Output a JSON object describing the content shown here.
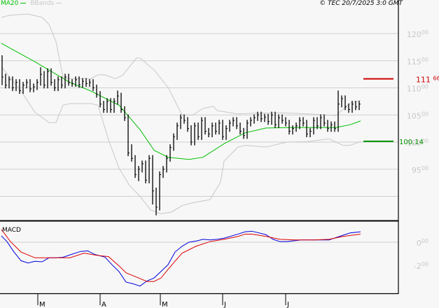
{
  "header": {
    "legend": [
      {
        "label": "MA20",
        "color": "#00c000"
      },
      {
        "label": "BBands",
        "color": "#c8c8c8"
      }
    ],
    "copyright": "© TEC 20/7/2025 3:0 GMT"
  },
  "chart_data": [
    {
      "type": "ohlc",
      "panel": "price",
      "ylim": [
        85,
        123
      ],
      "grid": true,
      "y_ticks": [
        {
          "value": 120,
          "int": "120",
          "dec": "00"
        },
        {
          "value": 115,
          "int": "115",
          "dec": "00"
        },
        {
          "value": 110,
          "int": "110",
          "dec": "00"
        },
        {
          "value": 105,
          "int": "105",
          "dec": "00"
        },
        {
          "value": 100,
          "int": "100",
          "dec": "00"
        },
        {
          "value": 95,
          "int": "95",
          "dec": "00"
        }
      ],
      "x_ticks": [
        {
          "bar": 10.2,
          "label": "M"
        },
        {
          "bar": 28,
          "label": "A"
        },
        {
          "bar": 45.2,
          "label": "M"
        },
        {
          "bar": 63,
          "label": "J"
        },
        {
          "bar": 81,
          "label": "J"
        }
      ],
      "bars_hlc": [
        [
          116,
          110.5,
          112
        ],
        [
          112.6,
          109.9,
          110.5
        ],
        [
          112.1,
          109.9,
          111.5
        ],
        [
          112.1,
          109.4,
          110
        ],
        [
          111.6,
          109.4,
          111
        ],
        [
          111.6,
          108.9,
          109.5
        ],
        [
          111.1,
          108.9,
          110.5
        ],
        [
          111.6,
          109.9,
          111
        ],
        [
          111.6,
          109.2,
          109.8
        ],
        [
          110.8,
          109.2,
          110.2
        ],
        [
          111.6,
          109.6,
          111
        ],
        [
          113.8,
          110.4,
          112.5
        ],
        [
          113.1,
          109.9,
          110.5
        ],
        [
          113.6,
          109.9,
          113
        ],
        [
          113.6,
          110.4,
          111
        ],
        [
          111.6,
          109.4,
          110
        ],
        [
          112.1,
          109.4,
          111.5
        ],
        [
          112.1,
          109.9,
          110.5
        ],
        [
          112.6,
          109.9,
          112
        ],
        [
          112.6,
          110.4,
          111
        ],
        [
          111.6,
          110.2,
          110.8
        ],
        [
          112.1,
          110.2,
          111.5
        ],
        [
          112.1,
          110,
          110.6
        ],
        [
          111.8,
          110,
          111.2
        ],
        [
          111.8,
          110.2,
          110.8
        ],
        [
          111.6,
          110.2,
          111
        ],
        [
          111.6,
          109.4,
          110
        ],
        [
          110.6,
          108.2,
          108.8
        ],
        [
          109.4,
          106.4,
          107
        ],
        [
          107.6,
          105.4,
          106
        ],
        [
          108.1,
          105.4,
          107.5
        ],
        [
          108.1,
          105.4,
          106
        ],
        [
          108.1,
          105.4,
          107.5
        ],
        [
          109.5,
          106.9,
          108.5
        ],
        [
          109.1,
          105.4,
          106
        ],
        [
          106.6,
          103.9,
          104.5
        ],
        [
          105.1,
          97.4,
          98
        ],
        [
          99.6,
          96.4,
          97
        ],
        [
          97.6,
          93.4,
          94
        ],
        [
          95.6,
          92.8,
          95
        ],
        [
          96.6,
          94.4,
          96
        ],
        [
          96.6,
          92.4,
          93
        ],
        [
          97.6,
          92.4,
          97
        ],
        [
          97.6,
          88.5,
          91
        ],
        [
          91.6,
          86.5,
          88
        ],
        [
          94.6,
          87.4,
          94
        ],
        [
          95.6,
          93.4,
          95
        ],
        [
          97.6,
          94.4,
          97
        ],
        [
          99.6,
          96.4,
          99
        ],
        [
          101.6,
          98.4,
          101
        ],
        [
          103.6,
          100.4,
          103
        ],
        [
          105.1,
          102.4,
          104.5
        ],
        [
          105.1,
          103.4,
          104
        ],
        [
          104.6,
          101.9,
          102.5
        ],
        [
          103.1,
          99.4,
          100
        ],
        [
          103.6,
          99.4,
          103
        ],
        [
          103.6,
          100.4,
          101
        ],
        [
          104.6,
          100.4,
          104
        ],
        [
          104.6,
          101.4,
          102
        ],
        [
          102.6,
          100.9,
          101.5
        ],
        [
          103.6,
          100.9,
          103
        ],
        [
          103.6,
          101.4,
          102
        ],
        [
          104.1,
          101.4,
          103.5
        ],
        [
          104.1,
          100.4,
          101
        ],
        [
          103.1,
          100.4,
          102.5
        ],
        [
          104.1,
          101.9,
          103.5
        ],
        [
          104.6,
          102.9,
          104
        ],
        [
          104.6,
          102.4,
          103
        ],
        [
          103.6,
          101.4,
          102
        ],
        [
          102.6,
          100.6,
          101.2
        ],
        [
          104.1,
          100.6,
          103.5
        ],
        [
          104.6,
          102.9,
          104
        ],
        [
          105.1,
          103.4,
          104.5
        ],
        [
          105.6,
          103.9,
          105
        ],
        [
          105.6,
          103.7,
          104.3
        ],
        [
          105.2,
          103.7,
          104.6
        ],
        [
          105.2,
          103.2,
          103.8
        ],
        [
          105.6,
          103.2,
          105
        ],
        [
          105.6,
          102.6,
          103.2
        ],
        [
          105.1,
          102.6,
          104.5
        ],
        [
          105.1,
          103.4,
          104
        ],
        [
          104.6,
          102.9,
          103.5
        ],
        [
          104.1,
          101.4,
          102
        ],
        [
          103.1,
          101.4,
          102.5
        ],
        [
          103.6,
          101.9,
          103
        ],
        [
          104.6,
          102.4,
          104
        ],
        [
          104.6,
          102.9,
          103.5
        ],
        [
          104.1,
          100.9,
          101.5
        ],
        [
          102.6,
          100.9,
          102
        ],
        [
          104.6,
          101.4,
          104
        ],
        [
          104.6,
          102.4,
          103
        ],
        [
          105.1,
          102.4,
          104.5
        ],
        [
          105.1,
          102.9,
          103.5
        ],
        [
          104.1,
          101.9,
          102.5
        ],
        [
          103.8,
          101.9,
          103.2
        ],
        [
          103.8,
          101.9,
          102.5
        ],
        [
          109.5,
          101.9,
          107
        ],
        [
          108.6,
          106.4,
          108
        ],
        [
          108.6,
          105.9,
          106.5
        ],
        [
          107.1,
          105.4,
          106
        ],
        [
          107.6,
          105.4,
          107
        ],
        [
          107.6,
          105.9,
          106.5
        ],
        [
          107.6,
          105.9,
          107
        ]
      ],
      "ma20": {
        "name": "MA20",
        "color": "#00c000",
        "points": [
          [
            -0.2,
            118.2
          ],
          [
            9.4,
            114.8
          ],
          [
            19.4,
            111
          ],
          [
            25.4,
            109.4
          ],
          [
            33.4,
            106.8
          ],
          [
            39.4,
            102.3
          ],
          [
            43.4,
            98.5
          ],
          [
            47.4,
            97.2
          ],
          [
            53.4,
            96.8
          ],
          [
            57.4,
            97.2
          ],
          [
            63.4,
            99.7
          ],
          [
            69.4,
            101.7
          ],
          [
            75.4,
            102.6
          ],
          [
            83.4,
            102.7
          ],
          [
            91.4,
            102.7
          ],
          [
            95.4,
            102.7
          ],
          [
            99.4,
            103.2
          ],
          [
            102.4,
            103.9
          ]
        ]
      },
      "bbands_upper": {
        "name": "BBands",
        "color": "#c8c8c8",
        "points": [
          [
            -0.2,
            123
          ],
          [
            2.4,
            123.4
          ],
          [
            7.4,
            123.6
          ],
          [
            11.4,
            123
          ],
          [
            13.4,
            121.7
          ],
          [
            15.4,
            118.5
          ],
          [
            17.4,
            112
          ],
          [
            18.4,
            111.7
          ],
          [
            25.4,
            111.7
          ],
          [
            27.4,
            112.4
          ],
          [
            29.4,
            112.4
          ],
          [
            32.4,
            111.7
          ],
          [
            34.4,
            112.3
          ],
          [
            36.4,
            113.9
          ],
          [
            38.4,
            115.5
          ],
          [
            39.4,
            115.5
          ],
          [
            43.4,
            113.3
          ],
          [
            47.4,
            110.1
          ],
          [
            51.4,
            105
          ],
          [
            54.4,
            105
          ],
          [
            57.4,
            106.2
          ],
          [
            60.4,
            106.6
          ],
          [
            61.4,
            105.8
          ],
          [
            67.4,
            105.2
          ],
          [
            71.4,
            105.3
          ],
          [
            79.4,
            105.4
          ],
          [
            87.4,
            105.2
          ],
          [
            95.4,
            104.9
          ],
          [
            96.4,
            105.5
          ],
          [
            99.4,
            107.2
          ],
          [
            102.4,
            107.7
          ]
        ]
      },
      "bbands_lower": {
        "name": "BBands",
        "color": "#c8c8c8",
        "points": [
          [
            -0.2,
            113.9
          ],
          [
            5.4,
            109.4
          ],
          [
            9.4,
            105.5
          ],
          [
            13.4,
            103.6
          ],
          [
            15.4,
            103.6
          ],
          [
            17.4,
            106.8
          ],
          [
            19.4,
            107.1
          ],
          [
            25.4,
            107.1
          ],
          [
            27.4,
            106.8
          ],
          [
            30.4,
            100.4
          ],
          [
            33.4,
            95.2
          ],
          [
            36.4,
            92
          ],
          [
            39.4,
            90
          ],
          [
            42.4,
            87.5
          ],
          [
            45.4,
            86.8
          ],
          [
            48.4,
            87.1
          ],
          [
            51.4,
            88.3
          ],
          [
            54.4,
            88.8
          ],
          [
            59.4,
            89.4
          ],
          [
            62.4,
            92.6
          ],
          [
            63.4,
            96.5
          ],
          [
            67.4,
            99.1
          ],
          [
            69.4,
            99.4
          ],
          [
            75.4,
            99.1
          ],
          [
            81.4,
            100
          ],
          [
            87.4,
            100.1
          ],
          [
            93.4,
            100.6
          ],
          [
            95.4,
            100
          ],
          [
            97.4,
            99.4
          ],
          [
            99.4,
            99.4
          ],
          [
            102.4,
            100.1
          ]
        ]
      },
      "levels": [
        {
          "value": 111.66,
          "int": "111",
          "dec": "66",
          "color": "#cc0000"
        },
        {
          "value": 100.14,
          "label": "100.14",
          "color": "#009000"
        }
      ]
    },
    {
      "type": "line",
      "panel": "indicator",
      "title": "MACD",
      "ylim": [
        -4.4,
        1.6
      ],
      "y_ticks": [
        {
          "value": 0,
          "int": "0",
          "dec": "00"
        },
        {
          "value": -2,
          "int": "-2",
          "dec": "00"
        }
      ],
      "series": [
        {
          "color": "#0000dd",
          "points": [
            [
              -0.2,
              0.55
            ],
            [
              1.4,
              0.05
            ],
            [
              3.4,
              -0.85
            ],
            [
              5.4,
              -1.6
            ],
            [
              7.4,
              -1.8
            ],
            [
              9.4,
              -1.65
            ],
            [
              11.4,
              -1.7
            ],
            [
              13.4,
              -1.35
            ],
            [
              15.4,
              -1.35
            ],
            [
              17.4,
              -1.3
            ],
            [
              19.4,
              -1.1
            ],
            [
              22.4,
              -0.8
            ],
            [
              24.4,
              -0.75
            ],
            [
              26.4,
              -1.05
            ],
            [
              29.4,
              -1.3
            ],
            [
              31.4,
              -1.95
            ],
            [
              33.4,
              -2.55
            ],
            [
              35.4,
              -3.45
            ],
            [
              37.4,
              -3.6
            ],
            [
              39.4,
              -3.8
            ],
            [
              41.4,
              -3.35
            ],
            [
              43.4,
              -3.1
            ],
            [
              47.4,
              -1.95
            ],
            [
              49.4,
              -0.85
            ],
            [
              51.4,
              -0.35
            ],
            [
              53.4,
              0
            ],
            [
              55.4,
              0.1
            ],
            [
              57.4,
              0.25
            ],
            [
              59.4,
              0.2
            ],
            [
              61.4,
              0.25
            ],
            [
              63.4,
              0.35
            ],
            [
              67.4,
              0.7
            ],
            [
              69.4,
              0.9
            ],
            [
              71.4,
              0.95
            ],
            [
              75.4,
              0.65
            ],
            [
              77.4,
              0.25
            ],
            [
              79.4,
              0.05
            ],
            [
              81.4,
              0.05
            ],
            [
              85.4,
              0.2
            ],
            [
              89.4,
              0.2
            ],
            [
              93.4,
              0.2
            ],
            [
              95.4,
              0.4
            ],
            [
              99.4,
              0.8
            ],
            [
              102.4,
              0.9
            ]
          ]
        },
        {
          "color": "#dd0000",
          "points": [
            [
              -0.2,
              1.1
            ],
            [
              2.4,
              0.05
            ],
            [
              5.4,
              -0.85
            ],
            [
              9.4,
              -1.35
            ],
            [
              13.4,
              -1.35
            ],
            [
              19.4,
              -1.35
            ],
            [
              23.4,
              -0.95
            ],
            [
              27.4,
              -1.15
            ],
            [
              30.4,
              -1.25
            ],
            [
              33.4,
              -2.05
            ],
            [
              35.4,
              -2.65
            ],
            [
              39.4,
              -3.15
            ],
            [
              41.4,
              -3.4
            ],
            [
              43.4,
              -3.4
            ],
            [
              45.4,
              -3.1
            ],
            [
              47.4,
              -2.35
            ],
            [
              49.4,
              -1.65
            ],
            [
              51.4,
              -0.95
            ],
            [
              55.4,
              -0.35
            ],
            [
              59.4,
              0.05
            ],
            [
              63.4,
              0.25
            ],
            [
              67.4,
              0.5
            ],
            [
              69.4,
              0.7
            ],
            [
              71.4,
              0.7
            ],
            [
              75.4,
              0.5
            ],
            [
              79.4,
              0.25
            ],
            [
              83.4,
              0.2
            ],
            [
              89.4,
              0.2
            ],
            [
              93.4,
              0.25
            ],
            [
              97.4,
              0.5
            ],
            [
              102.4,
              0.7
            ]
          ]
        }
      ]
    }
  ]
}
